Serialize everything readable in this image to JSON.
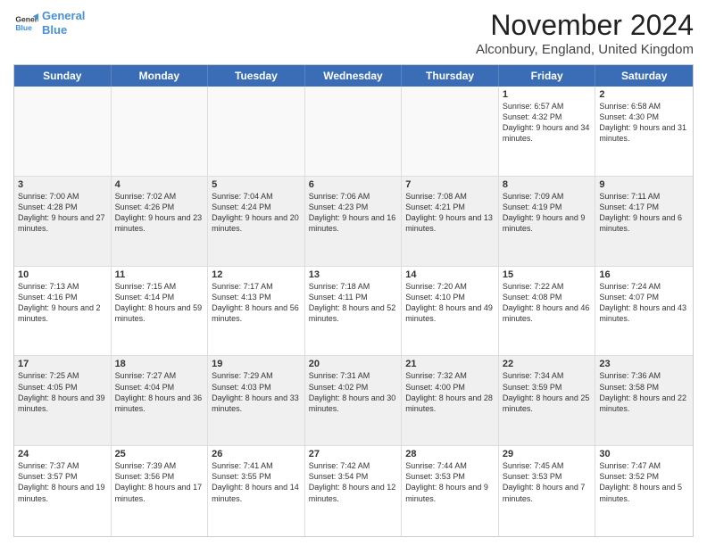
{
  "logo": {
    "line1": "General",
    "line2": "Blue"
  },
  "title": "November 2024",
  "location": "Alconbury, England, United Kingdom",
  "header_days": [
    "Sunday",
    "Monday",
    "Tuesday",
    "Wednesday",
    "Thursday",
    "Friday",
    "Saturday"
  ],
  "weeks": [
    [
      {
        "day": "",
        "info": ""
      },
      {
        "day": "",
        "info": ""
      },
      {
        "day": "",
        "info": ""
      },
      {
        "day": "",
        "info": ""
      },
      {
        "day": "",
        "info": ""
      },
      {
        "day": "1",
        "info": "Sunrise: 6:57 AM\nSunset: 4:32 PM\nDaylight: 9 hours and 34 minutes."
      },
      {
        "day": "2",
        "info": "Sunrise: 6:58 AM\nSunset: 4:30 PM\nDaylight: 9 hours and 31 minutes."
      }
    ],
    [
      {
        "day": "3",
        "info": "Sunrise: 7:00 AM\nSunset: 4:28 PM\nDaylight: 9 hours and 27 minutes."
      },
      {
        "day": "4",
        "info": "Sunrise: 7:02 AM\nSunset: 4:26 PM\nDaylight: 9 hours and 23 minutes."
      },
      {
        "day": "5",
        "info": "Sunrise: 7:04 AM\nSunset: 4:24 PM\nDaylight: 9 hours and 20 minutes."
      },
      {
        "day": "6",
        "info": "Sunrise: 7:06 AM\nSunset: 4:23 PM\nDaylight: 9 hours and 16 minutes."
      },
      {
        "day": "7",
        "info": "Sunrise: 7:08 AM\nSunset: 4:21 PM\nDaylight: 9 hours and 13 minutes."
      },
      {
        "day": "8",
        "info": "Sunrise: 7:09 AM\nSunset: 4:19 PM\nDaylight: 9 hours and 9 minutes."
      },
      {
        "day": "9",
        "info": "Sunrise: 7:11 AM\nSunset: 4:17 PM\nDaylight: 9 hours and 6 minutes."
      }
    ],
    [
      {
        "day": "10",
        "info": "Sunrise: 7:13 AM\nSunset: 4:16 PM\nDaylight: 9 hours and 2 minutes."
      },
      {
        "day": "11",
        "info": "Sunrise: 7:15 AM\nSunset: 4:14 PM\nDaylight: 8 hours and 59 minutes."
      },
      {
        "day": "12",
        "info": "Sunrise: 7:17 AM\nSunset: 4:13 PM\nDaylight: 8 hours and 56 minutes."
      },
      {
        "day": "13",
        "info": "Sunrise: 7:18 AM\nSunset: 4:11 PM\nDaylight: 8 hours and 52 minutes."
      },
      {
        "day": "14",
        "info": "Sunrise: 7:20 AM\nSunset: 4:10 PM\nDaylight: 8 hours and 49 minutes."
      },
      {
        "day": "15",
        "info": "Sunrise: 7:22 AM\nSunset: 4:08 PM\nDaylight: 8 hours and 46 minutes."
      },
      {
        "day": "16",
        "info": "Sunrise: 7:24 AM\nSunset: 4:07 PM\nDaylight: 8 hours and 43 minutes."
      }
    ],
    [
      {
        "day": "17",
        "info": "Sunrise: 7:25 AM\nSunset: 4:05 PM\nDaylight: 8 hours and 39 minutes."
      },
      {
        "day": "18",
        "info": "Sunrise: 7:27 AM\nSunset: 4:04 PM\nDaylight: 8 hours and 36 minutes."
      },
      {
        "day": "19",
        "info": "Sunrise: 7:29 AM\nSunset: 4:03 PM\nDaylight: 8 hours and 33 minutes."
      },
      {
        "day": "20",
        "info": "Sunrise: 7:31 AM\nSunset: 4:02 PM\nDaylight: 8 hours and 30 minutes."
      },
      {
        "day": "21",
        "info": "Sunrise: 7:32 AM\nSunset: 4:00 PM\nDaylight: 8 hours and 28 minutes."
      },
      {
        "day": "22",
        "info": "Sunrise: 7:34 AM\nSunset: 3:59 PM\nDaylight: 8 hours and 25 minutes."
      },
      {
        "day": "23",
        "info": "Sunrise: 7:36 AM\nSunset: 3:58 PM\nDaylight: 8 hours and 22 minutes."
      }
    ],
    [
      {
        "day": "24",
        "info": "Sunrise: 7:37 AM\nSunset: 3:57 PM\nDaylight: 8 hours and 19 minutes."
      },
      {
        "day": "25",
        "info": "Sunrise: 7:39 AM\nSunset: 3:56 PM\nDaylight: 8 hours and 17 minutes."
      },
      {
        "day": "26",
        "info": "Sunrise: 7:41 AM\nSunset: 3:55 PM\nDaylight: 8 hours and 14 minutes."
      },
      {
        "day": "27",
        "info": "Sunrise: 7:42 AM\nSunset: 3:54 PM\nDaylight: 8 hours and 12 minutes."
      },
      {
        "day": "28",
        "info": "Sunrise: 7:44 AM\nSunset: 3:53 PM\nDaylight: 8 hours and 9 minutes."
      },
      {
        "day": "29",
        "info": "Sunrise: 7:45 AM\nSunset: 3:53 PM\nDaylight: 8 hours and 7 minutes."
      },
      {
        "day": "30",
        "info": "Sunrise: 7:47 AM\nSunset: 3:52 PM\nDaylight: 8 hours and 5 minutes."
      }
    ]
  ]
}
